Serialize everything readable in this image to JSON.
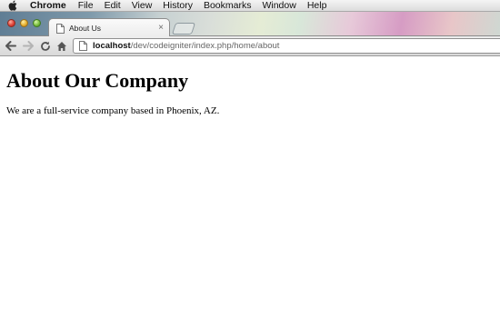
{
  "menubar": {
    "apple_icon": "apple-logo-icon",
    "app_name": "Chrome",
    "items": [
      "File",
      "Edit",
      "View",
      "History",
      "Bookmarks",
      "Window",
      "Help"
    ]
  },
  "tabs": [
    {
      "title": "About Us",
      "favicon": "page-icon",
      "close": "×"
    }
  ],
  "toolbar": {
    "back_icon": "back-arrow-icon",
    "forward_icon": "forward-arrow-icon",
    "reload_icon": "reload-icon",
    "home_icon": "home-icon",
    "url_host": "localhost",
    "url_path": "/dev/codeigniter/index.php/home/about"
  },
  "page": {
    "heading": "About Our Company",
    "paragraph": "We are a full-service company based in Phoenix, AZ."
  },
  "colors": {
    "traffic_close": "#e0443a",
    "traffic_minimize": "#e8b231",
    "traffic_maximize": "#7cc042"
  }
}
